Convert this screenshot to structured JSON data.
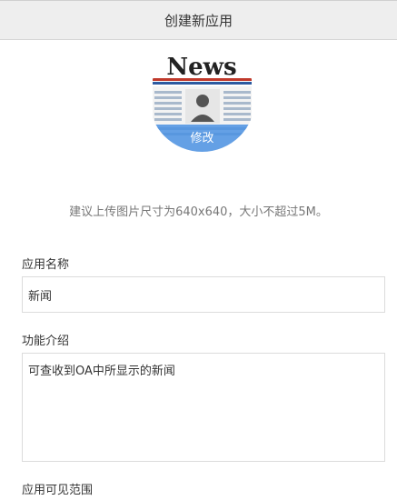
{
  "header": {
    "title": "创建新应用"
  },
  "avatar": {
    "image_text": "News",
    "edit_label": "修改",
    "hint": "建议上传图片尺寸为640x640，大小不超过5M。"
  },
  "form": {
    "name_label": "应用名称",
    "name_value": "新闻",
    "desc_label": "功能介绍",
    "desc_value": "可查收到OA中所显示的新闻",
    "range_label": "应用可见范围"
  }
}
